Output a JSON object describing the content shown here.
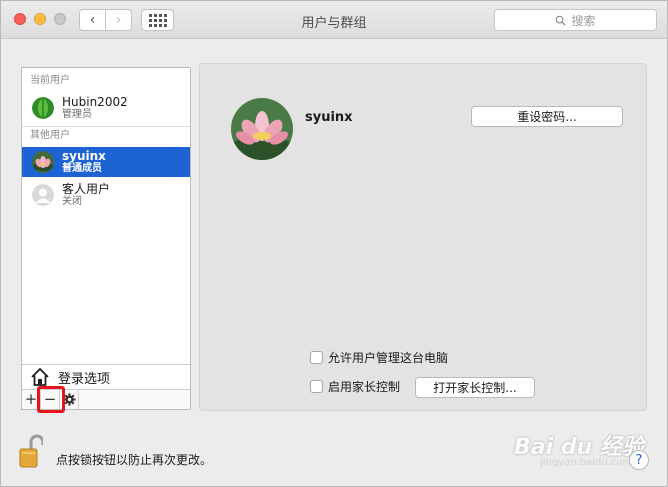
{
  "window": {
    "title": "用户与群组",
    "search_placeholder": "搜索"
  },
  "sidebar": {
    "current_header": "当前用户",
    "other_header": "其他用户",
    "users": [
      {
        "name": "Hubin2002",
        "role": "管理员"
      },
      {
        "name": "syuinx",
        "role": "普通成员"
      },
      {
        "name": "客人用户",
        "role": "关闭"
      }
    ],
    "login_options": "登录选项",
    "add_label": "+",
    "remove_label": "−"
  },
  "main": {
    "user_name": "syuinx",
    "reset_password": "重设密码...",
    "allow_admin": "允许用户管理这台电脑",
    "enable_parental": "启用家长控制",
    "open_parental": "打开家长控制..."
  },
  "footer": {
    "lock_text": "点按锁按钮以防止再次更改。",
    "help_label": "?"
  },
  "watermark": {
    "brand": "Bai du 经验",
    "url": "jingyan.baidu.com"
  },
  "colors": {
    "selection": "#1e63d4",
    "highlight_box": "#e8141c"
  }
}
